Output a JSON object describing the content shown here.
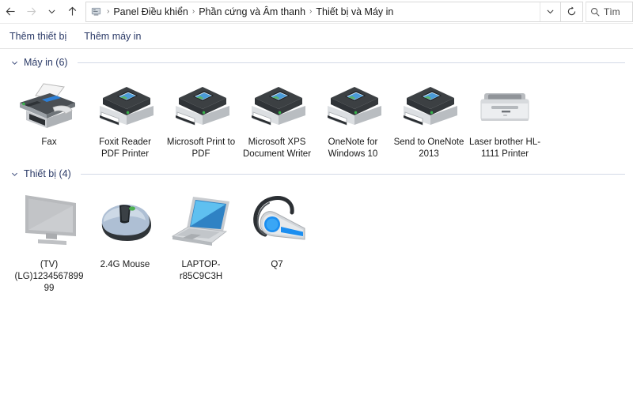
{
  "nav": {
    "back_label": "Back",
    "forward_label": "Forward",
    "recent_label": "Recent locations",
    "up_label": "Up",
    "breadcrumbs": [
      {
        "label": "Panel Điều khiển"
      },
      {
        "label": "Phần cứng và Âm thanh"
      },
      {
        "label": "Thiết bị và Máy in"
      }
    ],
    "separator": "›",
    "dropdown_label": "˅",
    "refresh_label": "Refresh"
  },
  "search": {
    "placeholder": "Tìm",
    "icon": "search-icon"
  },
  "toolbar": {
    "add_device_label": "Thêm thiết bị",
    "add_printer_label": "Thêm máy in"
  },
  "sections": [
    {
      "id": "printers",
      "title": "Máy in (6)",
      "chevron": "˅",
      "items": [
        {
          "label": "Fax",
          "icon": "fax-icon"
        },
        {
          "label": "Foxit Reader PDF Printer",
          "icon": "printer-icon"
        },
        {
          "label": "Microsoft Print to PDF",
          "icon": "printer-icon"
        },
        {
          "label": "Microsoft XPS Document Writer",
          "icon": "printer-icon"
        },
        {
          "label": "OneNote for Windows 10",
          "icon": "printer-icon"
        },
        {
          "label": "Send to OneNote 2013",
          "icon": "printer-icon"
        },
        {
          "label": "Laser brother HL-1111 Printer",
          "icon": "laser-printer-icon"
        }
      ]
    },
    {
      "id": "devices",
      "title": "Thiết bị (4)",
      "chevron": "˅",
      "items": [
        {
          "label": "(TV)(LG)123456789999",
          "icon": "monitor-icon"
        },
        {
          "label": "2.4G Mouse",
          "icon": "mouse-icon"
        },
        {
          "label": "LAPTOP-r85C9C3H",
          "icon": "laptop-icon"
        },
        {
          "label": "Q7",
          "icon": "headset-icon"
        }
      ]
    }
  ],
  "colors": {
    "link": "#2b3a67",
    "printer_dark": "#3c4043",
    "printer_light": "#d6d9dc",
    "led_green": "#37b34a",
    "laptop_screen": "#3aa6e8",
    "headset_blue": "#1b8ef0"
  }
}
